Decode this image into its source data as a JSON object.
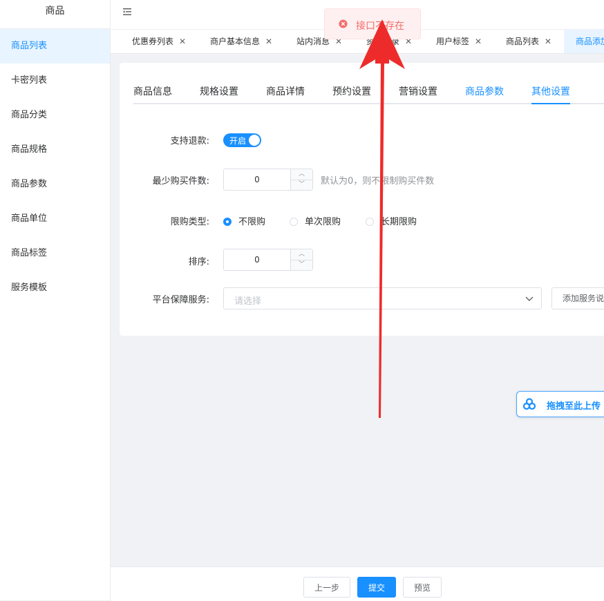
{
  "sidebar": {
    "title": "商品",
    "items": [
      {
        "label": "商品列表"
      },
      {
        "label": "卡密列表"
      },
      {
        "label": "商品分类"
      },
      {
        "label": "商品规格"
      },
      {
        "label": "商品参数"
      },
      {
        "label": "商品单位"
      },
      {
        "label": "商品标签"
      },
      {
        "label": "服务模板"
      }
    ]
  },
  "tags": [
    {
      "label": "优惠券列表"
    },
    {
      "label": "商户基本信息"
    },
    {
      "label": "站内消息"
    },
    {
      "label": "资金记录"
    },
    {
      "label": "用户标签"
    },
    {
      "label": "商品列表"
    },
    {
      "label": "商品添加"
    }
  ],
  "toast": {
    "message": "接口不存在",
    "color": "#f56c6c"
  },
  "tabs": [
    {
      "label": "商品信息"
    },
    {
      "label": "规格设置"
    },
    {
      "label": "商品详情"
    },
    {
      "label": "预约设置"
    },
    {
      "label": "营销设置"
    },
    {
      "label": "商品参数"
    },
    {
      "label": "其他设置"
    }
  ],
  "form": {
    "refund_label": "支持退款:",
    "refund_switch": "开启",
    "min_qty_label": "最少购买件数:",
    "min_qty_value": "0",
    "min_qty_hint": "默认为0，则不限制购买件数",
    "limit_type_label": "限购类型:",
    "limit_options": [
      "不限购",
      "单次限购",
      "长期限购"
    ],
    "sort_label": "排序:",
    "sort_value": "0",
    "guarantee_label": "平台保障服务:",
    "guarantee_placeholder": "请选择",
    "add_service_label": "添加服务说明"
  },
  "upload": {
    "label": "拖拽至此上传"
  },
  "footer": {
    "prev": "上一步",
    "submit": "提交",
    "preview": "预览"
  },
  "colors": {
    "accent": "#1890ff",
    "error": "#f56c6c",
    "arrow": "#ee2b2b"
  }
}
